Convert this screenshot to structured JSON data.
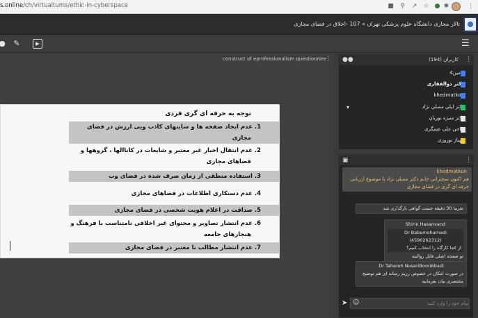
{
  "browser": {
    "url_host": "s.online",
    "url_path": "/ch/virtualtums/ethic-in-cyberspace"
  },
  "header": {
    "room_title": "تالار مجازی دانشگاه علوم پزشکی تهران » 107 -اخلاق در فضای مجازی"
  },
  "presentation": {
    "title": "construct of eprofessionalism questionnire",
    "heading": "توجه به حرفه ای گری فردی",
    "items": [
      {
        "text": "1.  عدم ایجاد صفحه ها و سایتهای کاذب وبی ارزش در فضای",
        "cont": "مجازی",
        "shade": true
      },
      {
        "text": "2.  عدم انتقال اخبار غیر معتبر و شایعات در کاناالها ، گروهها و",
        "cont": "فضاهای مجازی",
        "shade": false
      },
      {
        "text": "3.  استفاده منطقی از زمان صرف شده در فضای وب",
        "cont": "",
        "shade": true
      },
      {
        "text": "4.  عدم دستکاری اطلاعات  در فضاهای مجازی",
        "cont": "",
        "shade": false
      },
      {
        "text": "5.  صداقت در اعلام هویت شخصی در فضای مجازی",
        "cont": "",
        "shade": true
      },
      {
        "text": "6.  عدم انتشار تصاویر و محتوای غیر اخلاقی نامتناسب با فرهنگ و",
        "cont": "هنجارهای جامعه",
        "shade": false
      },
      {
        "text": "7.  عدم انتشار مطالب  نا معتبر در فضای مجازی",
        "cont": "",
        "shade": true
      }
    ]
  },
  "users": {
    "title": "کاربران (194)",
    "list": [
      {
        "name": "ادمین4",
        "color": "#3b82f6",
        "bold": false
      },
      {
        "name": "دکتر ذوالفقاری",
        "color": "#3b82f6",
        "bold": true
      },
      {
        "name": "khedmatkon",
        "color": "#3b82f6",
        "bold": false
      },
      {
        "name": "دکتر لیلی مصلی نژاد",
        "color": "#22c55e",
        "bold": false
      },
      {
        "name": "دکتر منیژه نوریان",
        "color": "#e6e6e6",
        "bold": false
      },
      {
        "name": "حاجی علی عسگری",
        "color": "#e6e6e6",
        "bold": false
      },
      {
        "name": "مهناز نوروزی",
        "color": "#facc15",
        "bold": false
      }
    ]
  },
  "chat": {
    "messages": [
      {
        "author": "khedmatkon",
        "text": "هم اکنون سخنرانی خانم دکتر مصلی نژاد با موضوع ارزیابی حرفه ای گری در فضای مجازی",
        "me": true
      },
      {
        "author": "",
        "text": "تقریبا 30 دقیقه جست گواهی بازگذاری شد",
        "me": false
      },
      {
        "author": "Shirin Hasanvand",
        "inner_author": "Dr Babamohamadi (4590262312)",
        "inner_text": "از کجا کارگاه را انتخاب کنیم؟",
        "text": "تو صفحه اصلی فایل روالیته",
        "me": false
      },
      {
        "author": "Dr Tahereh NaseriBooriAbadi",
        "text": "در صورت امکان در خصوص رزیم رسانه ای هم توضیح مختصری بیان بفرمایید",
        "me": false
      }
    ],
    "placeholder": "پیام خود را وارد کنید"
  }
}
